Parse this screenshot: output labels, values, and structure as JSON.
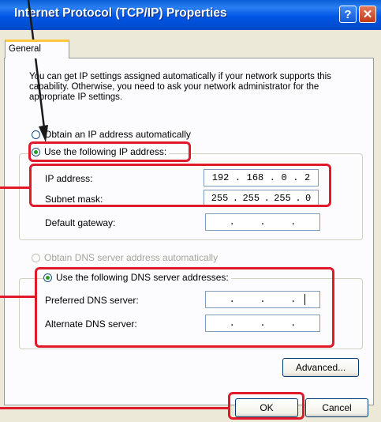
{
  "window": {
    "title": "Internet Protocol (TCP/IP) Properties",
    "help_glyph": "?",
    "close_glyph": "✕"
  },
  "tab": {
    "label": "General"
  },
  "intro_text": "You can get IP settings assigned automatically if your network supports this capability. Otherwise, you need to ask your network administrator for the appropriate IP settings.",
  "ip_options": {
    "auto_label": "Obtain an IP address automatically",
    "manual_label": "Use the following IP address:",
    "selected": "manual"
  },
  "ip_fields": [
    {
      "label": "IP address:",
      "octets": [
        "192",
        "168",
        "0",
        "2"
      ]
    },
    {
      "label": "Subnet mask:",
      "octets": [
        "255",
        "255",
        "255",
        "0"
      ]
    },
    {
      "label": "Default gateway:",
      "octets": [
        "",
        "",
        "",
        ""
      ]
    }
  ],
  "dns_options": {
    "auto_label": "Obtain DNS server address automatically",
    "manual_label": "Use the following DNS server addresses:",
    "selected": "manual"
  },
  "dns_fields": [
    {
      "label": "Preferred DNS server:",
      "octets": [
        "",
        "",
        "",
        ""
      ]
    },
    {
      "label": "Alternate DNS server:",
      "octets": [
        "",
        "",
        "",
        ""
      ]
    }
  ],
  "buttons": {
    "advanced": "Advanced...",
    "ok": "OK",
    "cancel": "Cancel"
  },
  "colors": {
    "highlight": "#e0192b",
    "titlebar": "#0055e5",
    "dialog_bg": "#ece9d8"
  }
}
